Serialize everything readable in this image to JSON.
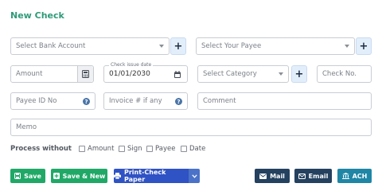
{
  "page": {
    "title": "New Check"
  },
  "row1": {
    "bank_account_placeholder": "Select Bank Account",
    "payee_placeholder": "Select Your Payee",
    "plus_label": "+"
  },
  "row2": {
    "amount_placeholder": "Amount",
    "date_legend": "Check issue date",
    "date_value": "01/01/2030",
    "category_placeholder": "Select Category",
    "check_no_placeholder": "Check No."
  },
  "row3": {
    "payee_id_placeholder": "Payee ID No",
    "invoice_placeholder": "Invoice # if any",
    "comment_placeholder": "Comment",
    "help_glyph": "?"
  },
  "row4": {
    "memo_placeholder": "Memo"
  },
  "process_without": {
    "label": "Process without",
    "options": [
      "Amount",
      "Sign",
      "Payee",
      "Date"
    ]
  },
  "buttons": {
    "save": "Save",
    "save_new": "Save & New",
    "print_check": "Print-Check Paper",
    "mail": "Mail",
    "email": "Email",
    "ach": "ACH"
  },
  "icons": {
    "calculator": "calculator-icon",
    "calendar": "calendar-icon",
    "help": "help-circle-icon",
    "save": "floppy-disk-icon",
    "add": "plus-square-icon",
    "print": "printer-icon",
    "mail": "envelope-icon",
    "email": "envelope-icon",
    "ach": "bank-icon"
  },
  "colors": {
    "title": "#2f9a78",
    "save_green": "#20a867",
    "print_blue": "#2f52c4",
    "mail_navy": "#24415f",
    "ach_teal": "#1f86a6"
  }
}
